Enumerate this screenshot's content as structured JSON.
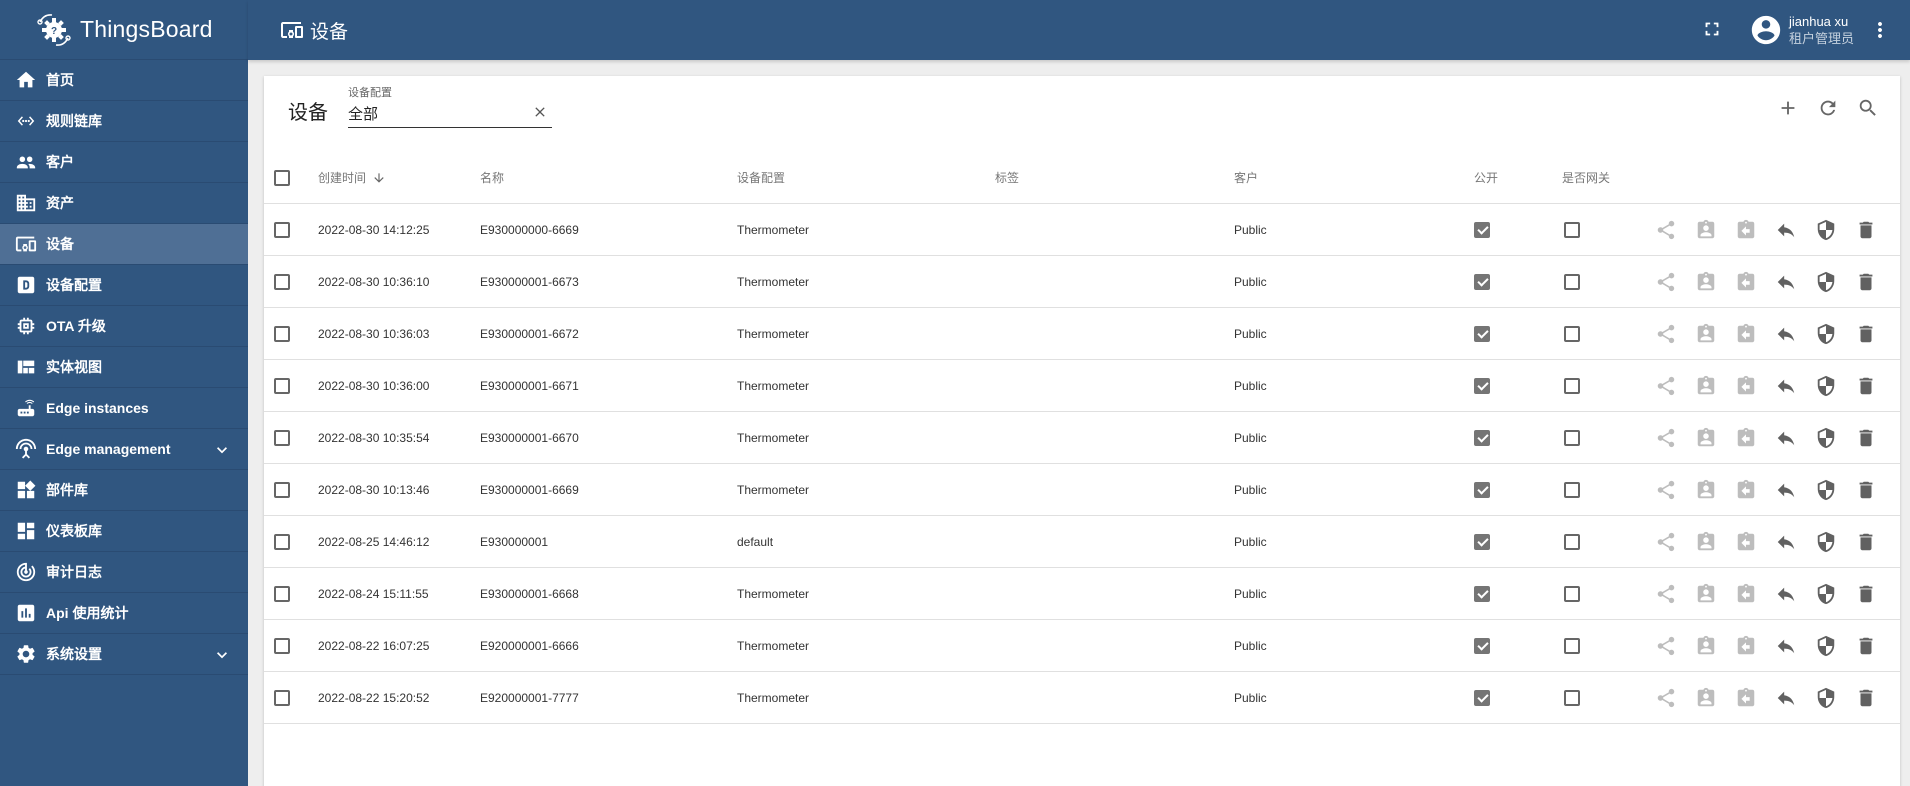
{
  "app": {
    "name": "ThingsBoard"
  },
  "sidebar": {
    "items": [
      {
        "label": "首页",
        "icon": "home-icon"
      },
      {
        "label": "规则链库",
        "icon": "code-icon"
      },
      {
        "label": "客户",
        "icon": "people-icon"
      },
      {
        "label": "资产",
        "icon": "domain-icon"
      },
      {
        "label": "设备",
        "icon": "devices-icon",
        "active": true
      },
      {
        "label": "设备配置",
        "icon": "device-profile-icon"
      },
      {
        "label": "OTA 升级",
        "icon": "memory-icon"
      },
      {
        "label": "实体视图",
        "icon": "view-quilt-icon"
      },
      {
        "label": "Edge instances",
        "icon": "router-icon"
      },
      {
        "label": "Edge management",
        "icon": "settings-input-antenna-icon",
        "expandable": true
      },
      {
        "label": "部件库",
        "icon": "widgets-icon"
      },
      {
        "label": "仪表板库",
        "icon": "dashboards-icon"
      },
      {
        "label": "审计日志",
        "icon": "track-changes-icon"
      },
      {
        "label": "Api 使用统计",
        "icon": "insert-chart-icon"
      },
      {
        "label": "系统设置",
        "icon": "settings-icon",
        "expandable": true
      }
    ]
  },
  "topbar": {
    "title": "设备",
    "user_name": "jianhua xu",
    "user_role": "租户管理员"
  },
  "card": {
    "title": "设备",
    "filter": {
      "label": "设备配置",
      "value": "全部"
    }
  },
  "table": {
    "columns": {
      "created_time": "创建时间",
      "name": "名称",
      "device_profile": "设备配置",
      "label": "标签",
      "customer": "客户",
      "public": "公开",
      "is_gateway": "是否网关"
    },
    "sort": {
      "column": "created_time",
      "direction": "desc"
    },
    "rows": [
      {
        "created_time": "2022-08-30 14:12:25",
        "name": "E930000000-6669",
        "device_profile": "Thermometer",
        "label": "",
        "customer": "Public",
        "public": true,
        "is_gateway": false
      },
      {
        "created_time": "2022-08-30 10:36:10",
        "name": "E930000001-6673",
        "device_profile": "Thermometer",
        "label": "",
        "customer": "Public",
        "public": true,
        "is_gateway": false
      },
      {
        "created_time": "2022-08-30 10:36:03",
        "name": "E930000001-6672",
        "device_profile": "Thermometer",
        "label": "",
        "customer": "Public",
        "public": true,
        "is_gateway": false
      },
      {
        "created_time": "2022-08-30 10:36:00",
        "name": "E930000001-6671",
        "device_profile": "Thermometer",
        "label": "",
        "customer": "Public",
        "public": true,
        "is_gateway": false
      },
      {
        "created_time": "2022-08-30 10:35:54",
        "name": "E930000001-6670",
        "device_profile": "Thermometer",
        "label": "",
        "customer": "Public",
        "public": true,
        "is_gateway": false
      },
      {
        "created_time": "2022-08-30 10:13:46",
        "name": "E930000001-6669",
        "device_profile": "Thermometer",
        "label": "",
        "customer": "Public",
        "public": true,
        "is_gateway": false
      },
      {
        "created_time": "2022-08-25 14:46:12",
        "name": "E930000001",
        "device_profile": "default",
        "label": "",
        "customer": "Public",
        "public": true,
        "is_gateway": false
      },
      {
        "created_time": "2022-08-24 15:11:55",
        "name": "E930000001-6668",
        "device_profile": "Thermometer",
        "label": "",
        "customer": "Public",
        "public": true,
        "is_gateway": false
      },
      {
        "created_time": "2022-08-22 16:07:25",
        "name": "E920000001-6666",
        "device_profile": "Thermometer",
        "label": "",
        "customer": "Public",
        "public": true,
        "is_gateway": false
      },
      {
        "created_time": "2022-08-22 15:20:52",
        "name": "E920000001-7777",
        "device_profile": "Thermometer",
        "label": "",
        "customer": "Public",
        "public": true,
        "is_gateway": false
      }
    ],
    "row_actions": [
      "share-icon",
      "assign-to-customer-icon",
      "unassign-icon",
      "make-private-icon",
      "credentials-icon",
      "delete-icon"
    ]
  }
}
